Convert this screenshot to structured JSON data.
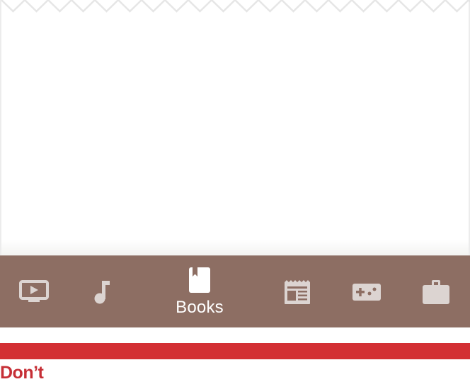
{
  "colors": {
    "tabbar_bg": "#8d6e63",
    "icon_inactive": "#dcd4d1",
    "icon_active": "#ffffff",
    "dont_bar": "#d32f33",
    "dont_text": "#c62f36"
  },
  "tabbar": {
    "tabs": [
      {
        "id": "video",
        "icon": "tv-play-icon",
        "label": "",
        "active": false
      },
      {
        "id": "music",
        "icon": "music-note-icon",
        "label": "",
        "active": false
      },
      {
        "id": "books",
        "icon": "book-bookmark-icon",
        "label": "Books",
        "active": true
      },
      {
        "id": "news",
        "icon": "newspaper-icon",
        "label": "",
        "active": false
      },
      {
        "id": "games",
        "icon": "gamepad-icon",
        "label": "",
        "active": false
      },
      {
        "id": "work",
        "icon": "briefcase-icon",
        "label": "",
        "active": false
      }
    ]
  },
  "caption": {
    "label": "Don’t"
  }
}
